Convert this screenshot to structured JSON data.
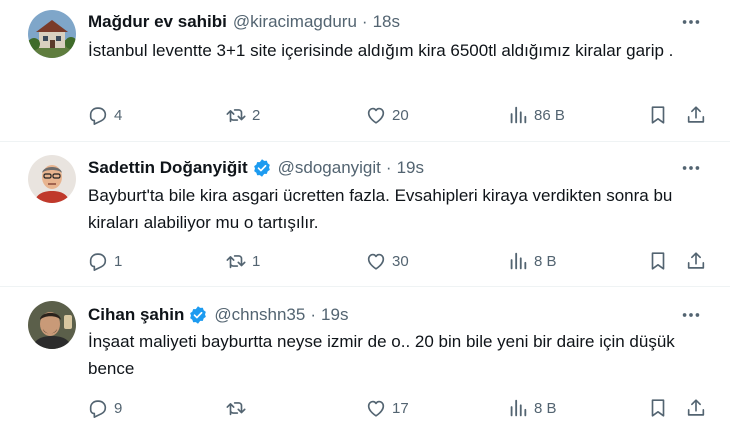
{
  "tweets": [
    {
      "name": "Mağdur ev sahibi",
      "verified": false,
      "handle": "@kiracimagduru",
      "separator": "·",
      "time": "18s",
      "text": "İstanbul leventte 3+1 site içerisinde aldığım kira 6500tl aldığımız kiralar garip .",
      "replies": "4",
      "retweets": "2",
      "likes": "20",
      "views": "86 B"
    },
    {
      "name": "Sadettin Doğanyiğit",
      "verified": true,
      "handle": "@sdoganyigit",
      "separator": "·",
      "time": "19s",
      "text": "Bayburt'ta bile kira asgari ücretten fazla. Evsahipleri kiraya verdikten sonra bu kiraları alabiliyor mu o tartışılır.",
      "replies": "1",
      "retweets": "1",
      "likes": "30",
      "views": "8 B"
    },
    {
      "name": "Cihan şahin",
      "verified": true,
      "handle": "@chnshn35",
      "separator": "·",
      "time": "19s",
      "text": "İnşaat maliyeti bayburtta neyse izmir de o.. 20 bin bile yeni bir daire için düşük bence",
      "replies": "9",
      "retweets": "",
      "likes": "17",
      "views": "8 B"
    }
  ],
  "colors": {
    "verified": "#1d9bf0",
    "secondary_text": "#536471",
    "primary_text": "#0f1419",
    "divider": "#eff3f4"
  },
  "icons": [
    "more-icon",
    "reply-icon",
    "retweet-icon",
    "like-icon",
    "views-icon",
    "bookmark-icon",
    "share-icon",
    "verified-badge-icon"
  ]
}
